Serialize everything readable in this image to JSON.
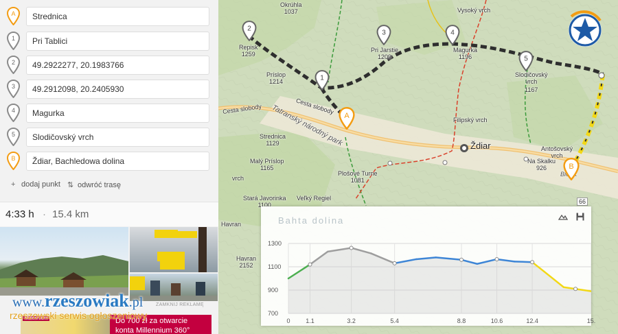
{
  "sidebar": {
    "waypoints": [
      {
        "marker": "A",
        "label": "Strednica"
      },
      {
        "marker": "1",
        "label": "Pri Tablici"
      },
      {
        "marker": "2",
        "label": "49.2922277, 20.1983766"
      },
      {
        "marker": "3",
        "label": "49.2912098, 20.2405930"
      },
      {
        "marker": "4",
        "label": "Magurka"
      },
      {
        "marker": "5",
        "label": "Slodičovský vrch"
      },
      {
        "marker": "B",
        "label": "Ždiar, Bachledowa dolina"
      }
    ],
    "add_point": "dodaj punkt",
    "reverse_route": "odwróć trasę",
    "duration": "4:33 h",
    "separator": "·",
    "distance": "15.4 km"
  },
  "ads": {
    "ad_label": "ZAMKNIJ REKLAMĘ",
    "bank_brand": "Millennium",
    "bank_line1": "Do 700 zł za otwarcie",
    "bank_line2": "konta Millennium 360°"
  },
  "watermark": {
    "prefix": "www.",
    "name": "rzeszowiak",
    "suffix": ".pl",
    "tagline": "rzeszowski serwis ogłoszeniowy"
  },
  "map": {
    "labels": [
      {
        "text": "Okrúhla",
        "sub": "1037"
      },
      {
        "text": "Vysoký vrch",
        "sub": ""
      },
      {
        "text": "Repisk",
        "sub": "1259"
      },
      {
        "text": "Príslop",
        "sub": "1214"
      },
      {
        "text": "Pri Jarstie",
        "sub": "1209"
      },
      {
        "text": "Magurka",
        "sub": "1196"
      },
      {
        "text": "Slodičovský",
        "sub": "vrch"
      },
      {
        "text": "1167",
        "sub": ""
      },
      {
        "text": "Cesta slobody",
        "sub": ""
      },
      {
        "text": "Cesta slobody",
        "sub": ""
      },
      {
        "text": "Tatranský národný park",
        "sub": ""
      },
      {
        "text": "Filipský vrch",
        "sub": ""
      },
      {
        "text": "Ždiar",
        "sub": ""
      },
      {
        "text": "Antošovský",
        "sub": "vrch"
      },
      {
        "text": "Strednica",
        "sub": "1129"
      },
      {
        "text": "Malý Príslop",
        "sub": "1165"
      },
      {
        "text": "Plošové Turne",
        "sub": "1081"
      },
      {
        "text": "Na Skalku",
        "sub": "926"
      },
      {
        "text": "vrch",
        "sub": ""
      },
      {
        "text": "Stará Javorinka",
        "sub": "1100"
      },
      {
        "text": "Veľký Regiel",
        "sub": ""
      },
      {
        "text": "Havran",
        "sub": ""
      },
      {
        "text": "Havran",
        "sub": "2152"
      },
      {
        "text": "66",
        "sub": ""
      },
      {
        "text": "Bielsk",
        "sub": ""
      }
    ],
    "markers": [
      "A",
      "1",
      "2",
      "3",
      "4",
      "5",
      "B"
    ]
  },
  "elevation": {
    "background_text": "Bahta dolina",
    "icons": [
      "terrain-icon",
      "save-icon"
    ],
    "chart_data": {
      "type": "line",
      "title": "",
      "xlabel": "",
      "ylabel": "",
      "x": [
        0,
        1.1,
        2.0,
        3.2,
        4.2,
        5.4,
        6.5,
        7.5,
        8.8,
        9.6,
        10.6,
        11.5,
        12.4,
        13.0,
        14.0,
        15.4
      ],
      "y": [
        1000,
        1120,
        1230,
        1262,
        1215,
        1130,
        1165,
        1180,
        1160,
        1125,
        1165,
        1145,
        1140,
        1060,
        925,
        890
      ],
      "segment_colors": [
        "#4caf50",
        "#9e9e9e",
        "#9e9e9e",
        "#9e9e9e",
        "#9e9e9e",
        "#3d85d6",
        "#3d85d6",
        "#3d85d6",
        "#3d85d6",
        "#3d85d6",
        "#3d85d6",
        "#3d85d6",
        "#f2d816",
        "#f2d816",
        "#f2d816"
      ],
      "xtick_labels": [
        "0",
        "1.1",
        "3.2",
        "5.4",
        "8.8",
        "10.6",
        "12.4",
        "15."
      ],
      "xtick_values": [
        0,
        1.1,
        3.2,
        5.4,
        8.8,
        10.6,
        12.4,
        15.4
      ],
      "ytick_labels": [
        "1300",
        "1100",
        "900",
        "700"
      ],
      "ytick_values": [
        1300,
        1100,
        900,
        700
      ],
      "ylim": [
        700,
        1300
      ],
      "xlim": [
        0,
        15.4
      ],
      "marker_x": [
        1.1,
        3.2,
        5.4,
        8.8,
        10.6,
        12.4,
        14.6
      ],
      "grid": true
    }
  },
  "colors": {
    "marker_orange": "#f39c12",
    "marker_gray": "#8a8a8a",
    "route_dark": "#333333",
    "route_yellow": "#f2d816"
  }
}
